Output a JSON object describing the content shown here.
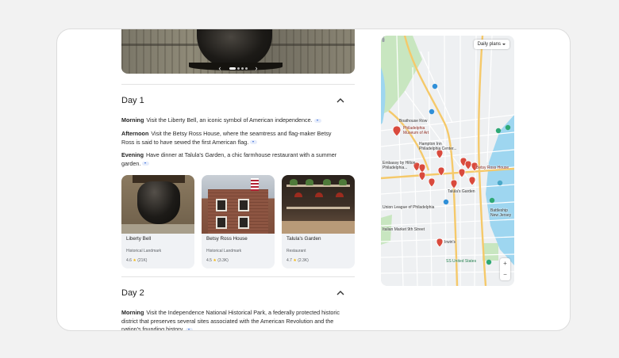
{
  "carousel": {
    "prev": "‹",
    "next": "›",
    "dots": 4,
    "active_dot": 0
  },
  "days": [
    {
      "title": "Day 1",
      "entries": [
        {
          "time": "Morning",
          "text": "Visit the Liberty Bell, an iconic symbol of American independence."
        },
        {
          "time": "Afternoon",
          "text": "Visit the Betsy Ross House, where the seamtress and flag-maker Betsy Ross is said to have sewed the first American flag."
        },
        {
          "time": "Evening",
          "text": "Have dinner at Talula's Garden, a chic farmhouse restaurant with a summer garden."
        }
      ],
      "places": [
        {
          "name": "Liberty Bell",
          "type": "Historical Landmark",
          "rating": "4.6",
          "reviews": "(21K)"
        },
        {
          "name": "Betsy Ross House",
          "type": "Historical Landmark",
          "rating": "4.5",
          "reviews": "(3.3K)"
        },
        {
          "name": "Talula's Garden",
          "type": "Restaurant",
          "rating": "4.7",
          "reviews": "(2.3K)"
        }
      ]
    },
    {
      "title": "Day 2",
      "entries": [
        {
          "time": "Morning",
          "text": "Visit the Independence National Historical Park, a federally protected historic district that preserves several sites associated with the American Revolution and the nation's founding history."
        }
      ]
    }
  ],
  "map": {
    "plans_button": "Daily plans",
    "zoom_in": "+",
    "zoom_out": "−",
    "labels": {
      "boathouse": "Boathouse Row",
      "museum": "Philadelphia\nMuseum of Art",
      "hampton": "Hampton Inn\nPhiladelphia Center...",
      "embassy": "Embassy by Hilton\nPhiladelphia...",
      "betsy": "Betsy Ross House",
      "talula": "Talula's Garden",
      "union": "Union League of Philadelphia",
      "italian": "Italian Market 9th Street",
      "irwins": "Irwin's",
      "battleship": "Battleship\nNew Jersey",
      "ssunited": "SS United States"
    },
    "colors": {
      "water": "#9ed6f0",
      "park": "#c8e6c0",
      "highway": "#f5c96a",
      "road": "#ffffff",
      "pin": "#d94a3d"
    }
  }
}
